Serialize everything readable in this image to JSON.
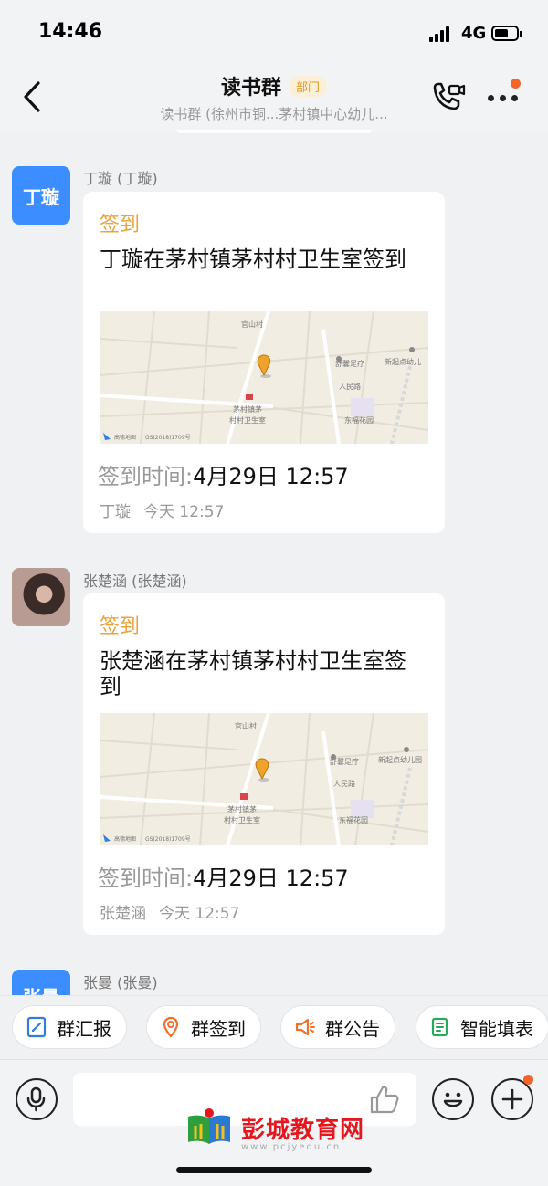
{
  "status_bar": {
    "time": "14:46",
    "network": "4G"
  },
  "header": {
    "title": "读书群",
    "tag": "部门",
    "subtitle": "读书群 (徐州市铜...茅村镇中心幼儿..."
  },
  "messages": [
    {
      "sender": "丁璇 (丁璇)",
      "avatar_text": "丁璇",
      "card_title": "签到",
      "card_text": "丁璇在茅村镇茅村村卫生室签到",
      "map": {
        "labels": [
          "官山村",
          "舒馨足疗",
          "新起点幼儿",
          "人民路",
          "茅村镇茅",
          "村村卫生室",
          "东福花园",
          "GS(2018)1709号",
          "高德地图"
        ]
      },
      "time_label": "签到时间:",
      "time_value": "4月29日 12:57",
      "footer_name": "丁璇",
      "footer_time": "今天 12:57"
    },
    {
      "sender": "张楚涵 (张楚涵)",
      "avatar_text": "",
      "card_title": "签到",
      "card_text": "张楚涵在茅村镇茅村村卫生室签到",
      "map": {
        "labels": [
          "官山村",
          "舒馨足疗",
          "新起点幼儿园",
          "人民路",
          "茅村镇茅",
          "村村卫生室",
          "东福花园",
          "GS(2018)1709号",
          "高德地图"
        ]
      },
      "time_label": "签到时间:",
      "time_value": "4月29日 12:57",
      "footer_name": "张楚涵",
      "footer_time": "今天 12:57"
    },
    {
      "sender": "张曼 (张曼)",
      "avatar_text": "张曼"
    }
  ],
  "quick_actions": [
    {
      "label": "群汇报",
      "icon": "report-icon"
    },
    {
      "label": "群签到",
      "icon": "location-pin-icon"
    },
    {
      "label": "群公告",
      "icon": "megaphone-icon"
    },
    {
      "label": "智能填表",
      "icon": "form-icon"
    }
  ],
  "watermark": {
    "text": "彭城教育网",
    "url": "www.pcjyedu.cn"
  },
  "colors": {
    "accent_orange": "#e9a33c",
    "avatar_blue": "#3c8dff",
    "notification_red": "#f2642a"
  }
}
